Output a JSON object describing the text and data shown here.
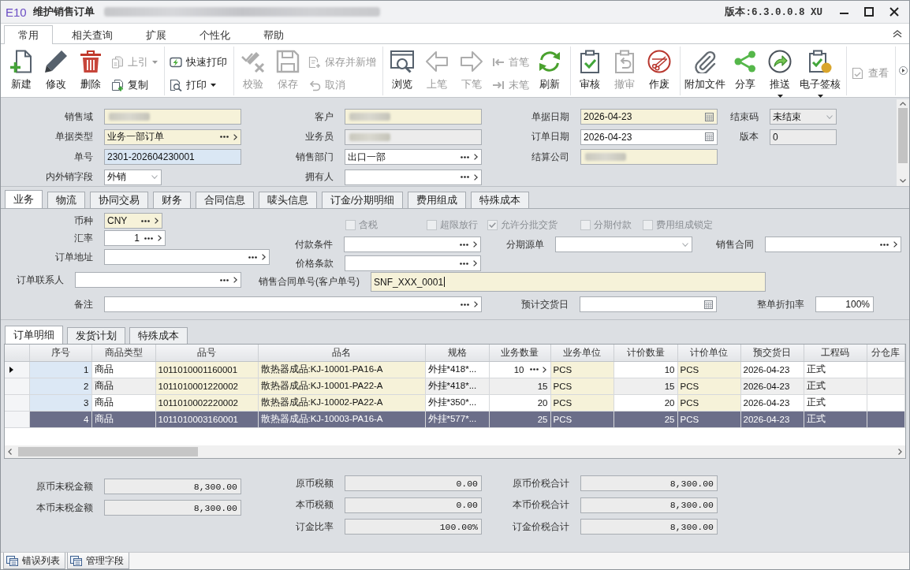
{
  "window": {
    "logo": "E10",
    "title": "维护销售订单",
    "subtitle_blurred": true,
    "version": "版本:6.3.0.0.8 XU"
  },
  "ribbon_tabs": [
    {
      "label": "常用",
      "selected": true
    },
    {
      "label": "相关查询",
      "selected": false
    },
    {
      "label": "扩展",
      "selected": false
    },
    {
      "label": "个性化",
      "selected": false
    },
    {
      "label": "帮助",
      "selected": false
    }
  ],
  "toolbar": {
    "groups": [
      {
        "items": [
          {
            "label": "新建",
            "kind": "large",
            "disabled": false,
            "menu": false
          },
          {
            "label": "修改",
            "kind": "large",
            "disabled": false,
            "menu": false
          },
          {
            "label": "删除",
            "kind": "large",
            "disabled": false,
            "menu": false
          },
          {
            "label": "上引",
            "kind": "small",
            "disabled": true,
            "menu": true
          },
          {
            "label": "复制",
            "kind": "small",
            "disabled": false,
            "menu": false
          }
        ]
      },
      {
        "items": [
          {
            "label": "快速打印",
            "kind": "small",
            "disabled": false,
            "menu": false
          },
          {
            "label": "打印",
            "kind": "small",
            "disabled": false,
            "menu": true
          }
        ]
      },
      {
        "items": [
          {
            "label": "校验",
            "kind": "large",
            "disabled": true,
            "menu": false
          },
          {
            "label": "保存",
            "kind": "large",
            "disabled": true,
            "menu": false
          },
          {
            "label": "保存并新增",
            "kind": "small",
            "disabled": true,
            "menu": false
          },
          {
            "label": "取消",
            "kind": "small",
            "disabled": true,
            "menu": false
          }
        ]
      },
      {
        "items": [
          {
            "label": "浏览",
            "kind": "large",
            "disabled": false,
            "menu": false
          },
          {
            "label": "上笔",
            "kind": "large",
            "disabled": true,
            "menu": false
          },
          {
            "label": "下笔",
            "kind": "large",
            "disabled": true,
            "menu": false
          },
          {
            "label": "首笔",
            "kind": "small",
            "disabled": true,
            "menu": false
          },
          {
            "label": "末笔",
            "kind": "small",
            "disabled": true,
            "menu": false
          },
          {
            "label": "刷新",
            "kind": "large",
            "disabled": false,
            "menu": false
          }
        ]
      },
      {
        "items": [
          {
            "label": "审核",
            "kind": "large",
            "disabled": false,
            "menu": false
          },
          {
            "label": "撤审",
            "kind": "large",
            "disabled": true,
            "menu": false
          },
          {
            "label": "作废",
            "kind": "large",
            "disabled": false,
            "menu": false
          }
        ]
      },
      {
        "items": [
          {
            "label": "附加文件",
            "kind": "large",
            "disabled": false,
            "menu": false
          },
          {
            "label": "分享",
            "kind": "large",
            "disabled": false,
            "menu": false
          },
          {
            "label": "推送",
            "kind": "large",
            "disabled": false,
            "menu": true
          },
          {
            "label": "电子签核",
            "kind": "large",
            "disabled": false,
            "menu": true
          }
        ]
      },
      {
        "items": [
          {
            "label": "查看",
            "kind": "small",
            "disabled": true,
            "menu": false
          }
        ]
      }
    ]
  },
  "header_form": {
    "columns": [
      {
        "fields": [
          {
            "label": "销售域",
            "kind": "lookup",
            "required": true,
            "blurred": true
          },
          {
            "label": "单据类型",
            "kind": "lookup",
            "required": true,
            "value": "业务一部订单"
          },
          {
            "label": "单号",
            "kind": "text",
            "highlighted": true,
            "value": "2301-202604230001"
          },
          {
            "label": "内外销字段",
            "kind": "dropdown",
            "value": "外销"
          }
        ]
      },
      {
        "fields": [
          {
            "label": "客户",
            "kind": "lookup",
            "required": true,
            "blurred": true
          },
          {
            "label": "业务员",
            "kind": "lookup",
            "readonly": true,
            "blurred": true
          },
          {
            "label": "销售部门",
            "kind": "lookup",
            "value": "出口一部"
          },
          {
            "label": "拥有人",
            "kind": "lookup"
          }
        ]
      },
      {
        "fields": [
          {
            "label": "单据日期",
            "kind": "date",
            "required": true,
            "value": "2026-04-23"
          },
          {
            "label": "订单日期",
            "kind": "date",
            "value": "2026-04-23"
          },
          {
            "label": "结算公司",
            "kind": "lookup",
            "required": true,
            "blurred": true
          }
        ]
      },
      {
        "fields": [
          {
            "label": "结束码",
            "kind": "dropdown",
            "readonly": true,
            "value": "未结束"
          },
          {
            "label": "版本",
            "kind": "text",
            "readonly": true,
            "value": "0"
          }
        ]
      }
    ]
  },
  "form_tabs": [
    {
      "label": "业务",
      "selected": true
    },
    {
      "label": "物流",
      "selected": false
    },
    {
      "label": "协同交易",
      "selected": false
    },
    {
      "label": "财务",
      "selected": false
    },
    {
      "label": "合同信息",
      "selected": false
    },
    {
      "label": "唛头信息",
      "selected": false
    },
    {
      "label": "订金/分期明细",
      "selected": false
    },
    {
      "label": "费用组成",
      "selected": false
    },
    {
      "label": "特殊成本",
      "selected": false
    }
  ],
  "business": {
    "checkboxes": [
      {
        "label": "含税",
        "checked": false,
        "disabled": true
      },
      {
        "label": "超限放行",
        "checked": false,
        "disabled": true
      },
      {
        "label": "允许分批交货",
        "checked": true,
        "disabled": true
      },
      {
        "label": "分期付款",
        "checked": false,
        "disabled": true
      },
      {
        "label": "费用组成锁定",
        "checked": false,
        "disabled": true
      }
    ],
    "fields": [
      {
        "label": "币种",
        "kind": "lookup",
        "required": true,
        "value": "CNY"
      },
      {
        "label": "汇率",
        "kind": "lookup",
        "value": "1",
        "numeric": true
      },
      {
        "label": "付款条件",
        "kind": "lookup"
      },
      {
        "label": "分期源单",
        "kind": "dropdown"
      },
      {
        "label": "销售合同",
        "kind": "lookup"
      },
      {
        "label": "订单地址",
        "kind": "lookup"
      },
      {
        "label": "价格条款",
        "kind": "lookup"
      },
      {
        "label": "订单联系人",
        "kind": "lookup"
      },
      {
        "label": "销售合同单号(客户单号)",
        "kind": "text",
        "required": true,
        "value": "SNF_XXX_0001",
        "focused": true
      },
      {
        "label": "备注",
        "kind": "lookup"
      },
      {
        "label": "预计交货日",
        "kind": "date"
      },
      {
        "label": "整单折扣率",
        "kind": "text",
        "value": "100%",
        "numeric": true
      }
    ]
  },
  "detail_tabs": [
    {
      "label": "订单明细",
      "selected": true
    },
    {
      "label": "发货计划",
      "selected": false
    },
    {
      "label": "特殊成本",
      "selected": false
    }
  ],
  "table": {
    "columns": [
      {
        "label": "序号",
        "kind": "index",
        "required": false
      },
      {
        "label": "商品类型",
        "kind": "text",
        "required": false
      },
      {
        "label": "品号",
        "kind": "text",
        "required": true
      },
      {
        "label": "品名",
        "kind": "text",
        "required": true
      },
      {
        "label": "规格",
        "kind": "text",
        "required": false
      },
      {
        "label": "业务数量",
        "kind": "number",
        "required": false
      },
      {
        "label": "业务单位",
        "kind": "text",
        "required": true
      },
      {
        "label": "计价数量",
        "kind": "number",
        "required": false
      },
      {
        "label": "计价单位",
        "kind": "text",
        "required": true
      },
      {
        "label": "预交货日",
        "kind": "text",
        "required": false
      },
      {
        "label": "工程码",
        "kind": "text",
        "required": false
      },
      {
        "label": "分仓库",
        "kind": "text",
        "required": false
      }
    ],
    "rows": [
      {
        "current": true,
        "selected": false,
        "cells": [
          "1",
          "商品",
          "1011010001160001",
          "散热器成品:KJ-10001-PA16-A",
          "外挂*418*...",
          {
            "text": "10",
            "editing": true
          },
          "PCS",
          "10",
          "PCS",
          "2026-04-23",
          "正式"
        ]
      },
      {
        "current": false,
        "selected": false,
        "cells": [
          "2",
          "商品",
          "1011010001220002",
          "散热器成品:KJ-10001-PA22-A",
          "外挂*418*...",
          "15",
          "PCS",
          "15",
          "PCS",
          "2026-04-23",
          "正式"
        ]
      },
      {
        "current": false,
        "selected": false,
        "cells": [
          "3",
          "商品",
          "1011010002220002",
          "散热器成品:KJ-10002-PA22-A",
          "外挂*350*...",
          "20",
          "PCS",
          "20",
          "PCS",
          "2026-04-23",
          "正式"
        ]
      },
      {
        "current": false,
        "selected": true,
        "cells": [
          "4",
          "商品",
          "1011010003160001",
          "散热器成品:KJ-10003-PA16-A",
          "外挂*577*...",
          "25",
          "PCS",
          "25",
          "PCS",
          "2026-04-23",
          "正式"
        ]
      }
    ]
  },
  "totals": {
    "columns": [
      {
        "fields": [
          {
            "label": "原币未税金额",
            "value": "8,300.00"
          },
          {
            "label": "本币未税金额",
            "value": "8,300.00"
          }
        ]
      },
      {
        "fields": [
          {
            "label": "原币税额",
            "value": "0.00"
          },
          {
            "label": "本币税额",
            "value": "0.00"
          },
          {
            "label": "订金比率",
            "value": "100.00%"
          }
        ]
      },
      {
        "fields": [
          {
            "label": "原币价税合计",
            "value": "8,300.00"
          },
          {
            "label": "本币价税合计",
            "value": "8,300.00"
          },
          {
            "label": "订金价税合计",
            "value": "8,300.00"
          }
        ]
      }
    ]
  },
  "bottom_tabs": [
    {
      "label": "错误列表"
    },
    {
      "label": "管理字段"
    }
  ]
}
